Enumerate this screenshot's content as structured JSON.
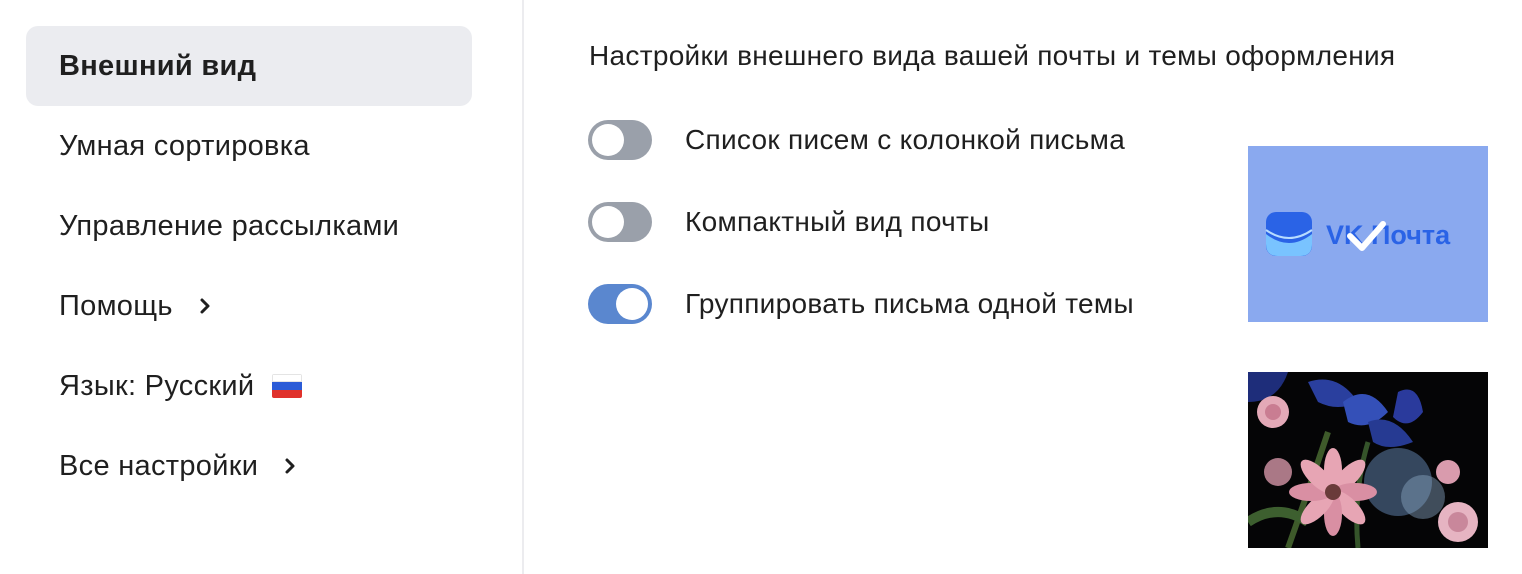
{
  "sidebar": {
    "items": [
      {
        "label": "Внешний вид"
      },
      {
        "label": "Умная сортировка"
      },
      {
        "label": "Управление рассылками"
      },
      {
        "label": "Помощь"
      },
      {
        "label": "Язык: Русский"
      },
      {
        "label": "Все настройки"
      }
    ]
  },
  "main": {
    "title": "Настройки внешнего вида вашей почты и темы оформления",
    "toggles": [
      {
        "label": "Список писем с колонкой письма",
        "on": false
      },
      {
        "label": "Компактный вид почты",
        "on": false
      },
      {
        "label": "Группировать письма одной темы",
        "on": true
      }
    ],
    "themes": [
      {
        "name": "vk-mail-theme",
        "logo_text": "VK Почта",
        "selected": true
      },
      {
        "name": "flowers-theme",
        "selected": false
      }
    ]
  },
  "colors": {
    "accent": "#5a87cf",
    "toggle_off": "#9aa0aa",
    "active_item_bg": "#ebecf0",
    "vk_theme_bg": "#8aa9ef",
    "logo_blue": "#2a63e6"
  }
}
